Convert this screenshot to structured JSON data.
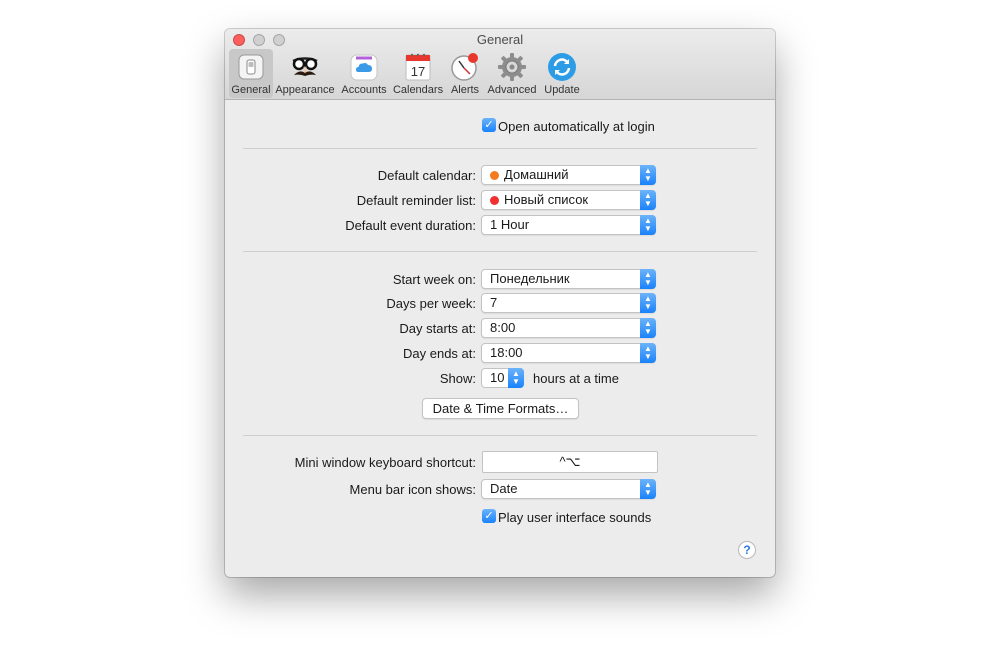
{
  "window": {
    "title": "General"
  },
  "toolbar": {
    "items": [
      {
        "label": "General",
        "icon": "general-switch-icon"
      },
      {
        "label": "Appearance",
        "icon": "glasses-mustache-icon"
      },
      {
        "label": "Accounts",
        "icon": "cloud-icon"
      },
      {
        "label": "Calendars",
        "icon": "calendar-icon",
        "date": "17"
      },
      {
        "label": "Alerts",
        "icon": "clock-alert-icon"
      },
      {
        "label": "Advanced",
        "icon": "gear-icon"
      },
      {
        "label": "Update",
        "icon": "refresh-icon"
      }
    ]
  },
  "general": {
    "open_at_login": {
      "label": "Open automatically at login",
      "checked": true
    },
    "default_calendar": {
      "label": "Default calendar:",
      "value": "Домашний",
      "color": "#f47a20"
    },
    "default_reminder_list": {
      "label": "Default reminder list:",
      "value": "Новый список",
      "color": "#f03030"
    },
    "default_event_duration": {
      "label": "Default event duration:",
      "value": "1 Hour"
    },
    "start_week_on": {
      "label": "Start week on:",
      "value": "Понедельник"
    },
    "days_per_week": {
      "label": "Days per week:",
      "value": "7"
    },
    "day_starts_at": {
      "label": "Day starts at:",
      "value": "8:00"
    },
    "day_ends_at": {
      "label": "Day ends at:",
      "value": "18:00"
    },
    "show": {
      "label": "Show:",
      "value": "10",
      "suffix": "hours at a time"
    },
    "date_time_formats_button": "Date & Time Formats…",
    "mini_window_shortcut": {
      "label": "Mini window keyboard shortcut:",
      "value": "^⌥"
    },
    "menu_bar_icon_shows": {
      "label": "Menu bar icon shows:",
      "value": "Date"
    },
    "play_ui_sounds": {
      "label": "Play user interface sounds",
      "checked": true
    },
    "help": "?"
  },
  "colors": {
    "accent": "#1a82fb",
    "close_button": "#fc605c"
  }
}
